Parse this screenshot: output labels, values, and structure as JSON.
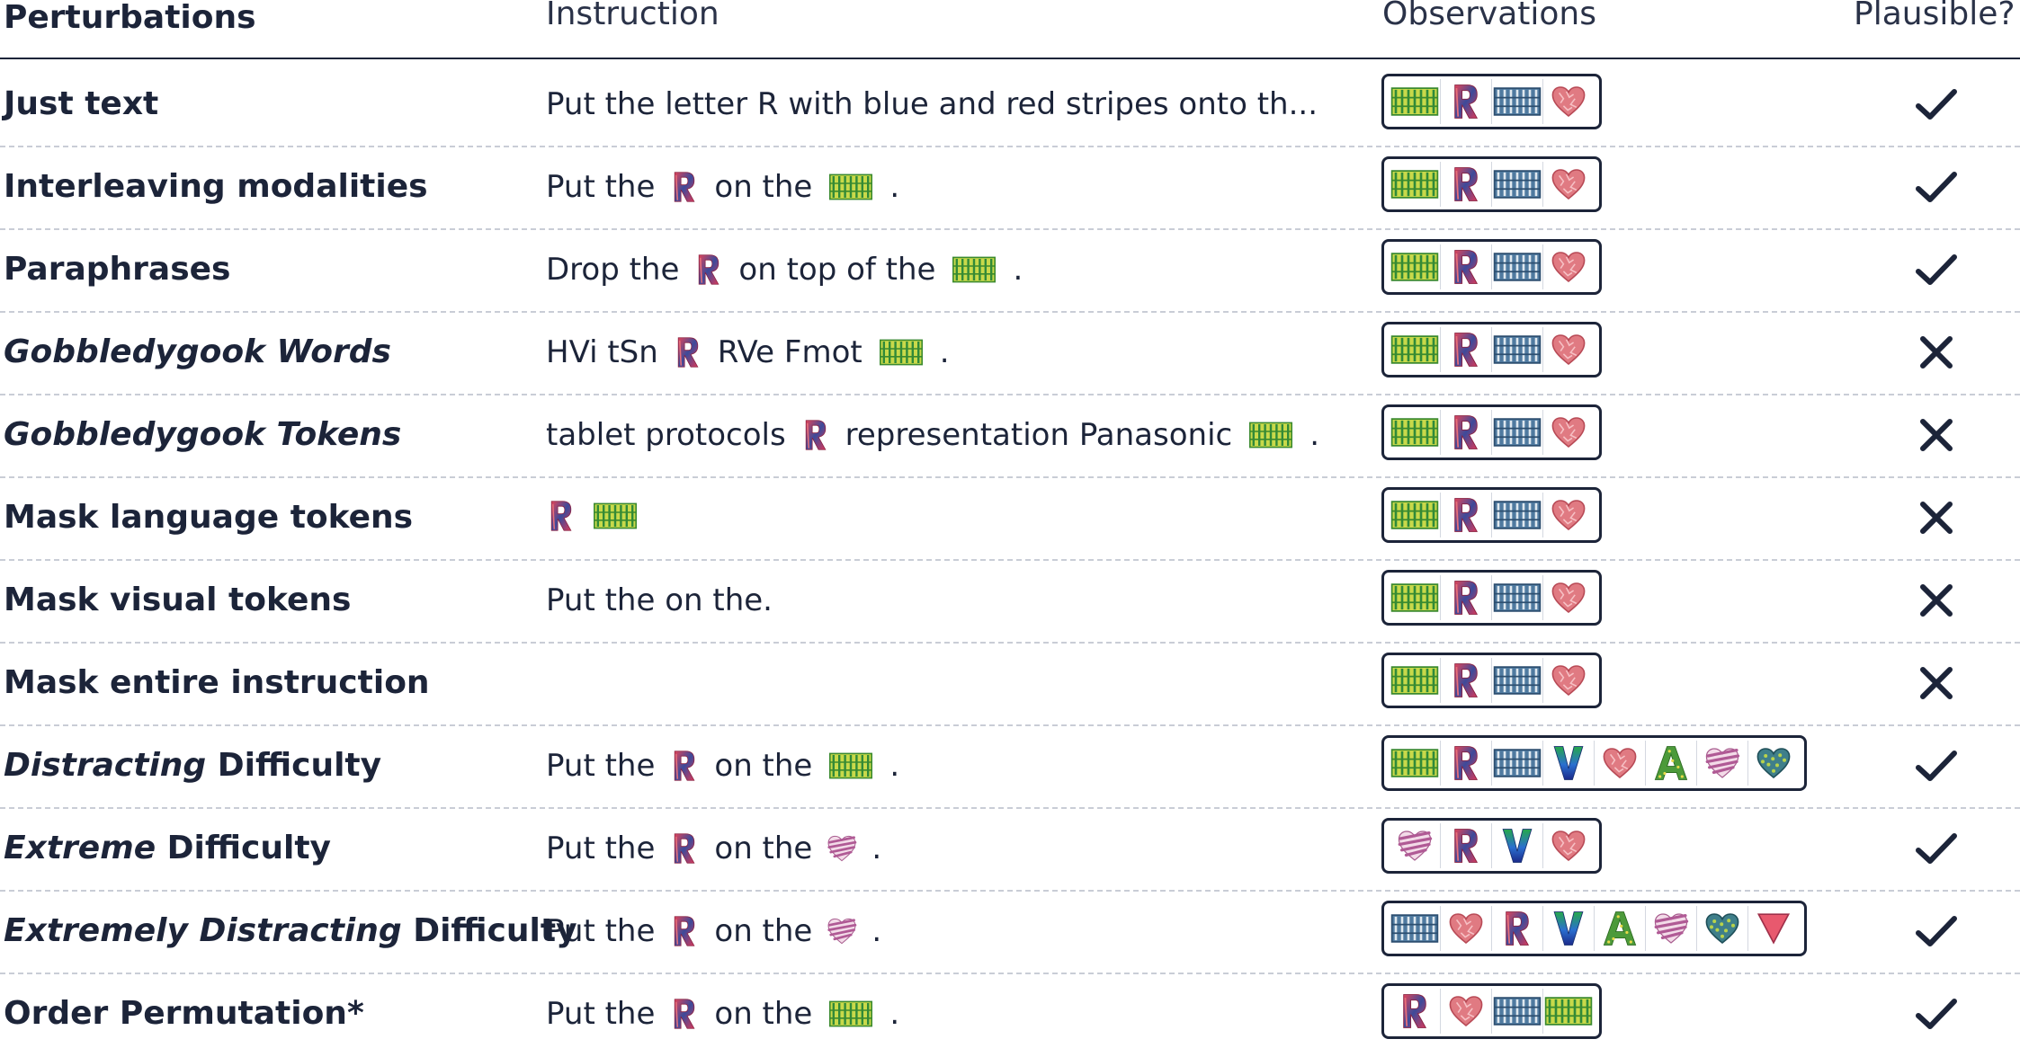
{
  "header": {
    "perturbations": "Perturbations",
    "instruction": "Instruction",
    "observations": "Observations",
    "plausible": "Plausible?"
  },
  "icons": {
    "R": "letter-r-blue-red-stripes",
    "G": "green-yellow-grid-frame",
    "B": "blue-grid-frame",
    "H": "red-textured-heart",
    "V": "letter-v-rainbow",
    "A": "letter-a-green-dotted",
    "S": "purple-striped-heart",
    "T": "teal-dotted-heart",
    "D": "pink-triangle"
  },
  "colors": {
    "text": "#1c2439",
    "rule": "#1c2439",
    "separator": "#c9cdd6",
    "check": "#1c2439",
    "cross": "#1c2439"
  },
  "rows": [
    {
      "label": [
        {
          "t": "Just text",
          "i": false
        }
      ],
      "instruction": [
        {
          "w": "Put the letter R with blue and red stripes onto th..."
        }
      ],
      "observations": [
        "G",
        "R",
        "B",
        "H"
      ],
      "plausible": true
    },
    {
      "label": [
        {
          "t": "Interleaving modalities",
          "i": false
        }
      ],
      "instruction": [
        {
          "w": "Put the"
        },
        {
          "icon": "R"
        },
        {
          "w": "on the"
        },
        {
          "icon": "G"
        },
        {
          "w": "."
        }
      ],
      "observations": [
        "G",
        "R",
        "B",
        "H"
      ],
      "plausible": true
    },
    {
      "label": [
        {
          "t": "Paraphrases",
          "i": false
        }
      ],
      "instruction": [
        {
          "w": "Drop the"
        },
        {
          "icon": "R"
        },
        {
          "w": "on top of the"
        },
        {
          "icon": "G"
        },
        {
          "w": "."
        }
      ],
      "observations": [
        "G",
        "R",
        "B",
        "H"
      ],
      "plausible": true
    },
    {
      "label": [
        {
          "t": "Gobbledygook Words",
          "i": true
        }
      ],
      "instruction": [
        {
          "w": "HVi tSn"
        },
        {
          "icon": "R"
        },
        {
          "w": "RVe Fmot"
        },
        {
          "icon": "G"
        },
        {
          "w": "."
        }
      ],
      "observations": [
        "G",
        "R",
        "B",
        "H"
      ],
      "plausible": false
    },
    {
      "label": [
        {
          "t": "Gobbledygook Tokens",
          "i": true
        }
      ],
      "instruction": [
        {
          "w": "tablet protocols"
        },
        {
          "icon": "R"
        },
        {
          "w": "representation Panasonic"
        },
        {
          "icon": "G"
        },
        {
          "w": "."
        }
      ],
      "observations": [
        "G",
        "R",
        "B",
        "H"
      ],
      "plausible": false
    },
    {
      "label": [
        {
          "t": "Mask language tokens",
          "i": false
        }
      ],
      "instruction": [
        {
          "icon": "R"
        },
        {
          "icon": "G"
        }
      ],
      "observations": [
        "G",
        "R",
        "B",
        "H"
      ],
      "plausible": false
    },
    {
      "label": [
        {
          "t": "Mask visual tokens",
          "i": false
        }
      ],
      "instruction": [
        {
          "w": "Put the on the."
        }
      ],
      "observations": [
        "G",
        "R",
        "B",
        "H"
      ],
      "plausible": false
    },
    {
      "label": [
        {
          "t": "Mask entire instruction",
          "i": false
        }
      ],
      "instruction": [],
      "observations": [
        "G",
        "R",
        "B",
        "H"
      ],
      "plausible": false
    },
    {
      "label": [
        {
          "t": "Distracting",
          "i": true
        },
        {
          "t": " Difficulty",
          "i": false
        }
      ],
      "instruction": [
        {
          "w": "Put the"
        },
        {
          "icon": "R"
        },
        {
          "w": "on the"
        },
        {
          "icon": "G"
        },
        {
          "w": "."
        }
      ],
      "observations": [
        "G",
        "R",
        "B",
        "V",
        "H",
        "A",
        "S",
        "T"
      ],
      "plausible": true
    },
    {
      "label": [
        {
          "t": "Extreme",
          "i": true
        },
        {
          "t": " Difficulty",
          "i": false
        }
      ],
      "instruction": [
        {
          "w": "Put the"
        },
        {
          "icon": "R"
        },
        {
          "w": "on the"
        },
        {
          "icon": "S"
        },
        {
          "w": "."
        }
      ],
      "observations": [
        "S",
        "R",
        "V",
        "H"
      ],
      "plausible": true
    },
    {
      "label": [
        {
          "t": "Extremely Distracting",
          "i": true
        },
        {
          "t": " Difficulty",
          "i": false
        }
      ],
      "instruction": [
        {
          "w": "Put the"
        },
        {
          "icon": "R"
        },
        {
          "w": "on the"
        },
        {
          "icon": "S"
        },
        {
          "w": "."
        }
      ],
      "observations": [
        "B",
        "H",
        "R",
        "V",
        "A",
        "S",
        "T",
        "D"
      ],
      "plausible": true
    },
    {
      "label": [
        {
          "t": "Order Permutation*",
          "i": false
        }
      ],
      "instruction": [
        {
          "w": "Put the"
        },
        {
          "icon": "R"
        },
        {
          "w": "on the"
        },
        {
          "icon": "G"
        },
        {
          "w": "."
        }
      ],
      "observations": [
        "R",
        "H",
        "B",
        "G"
      ],
      "plausible": true
    }
  ]
}
